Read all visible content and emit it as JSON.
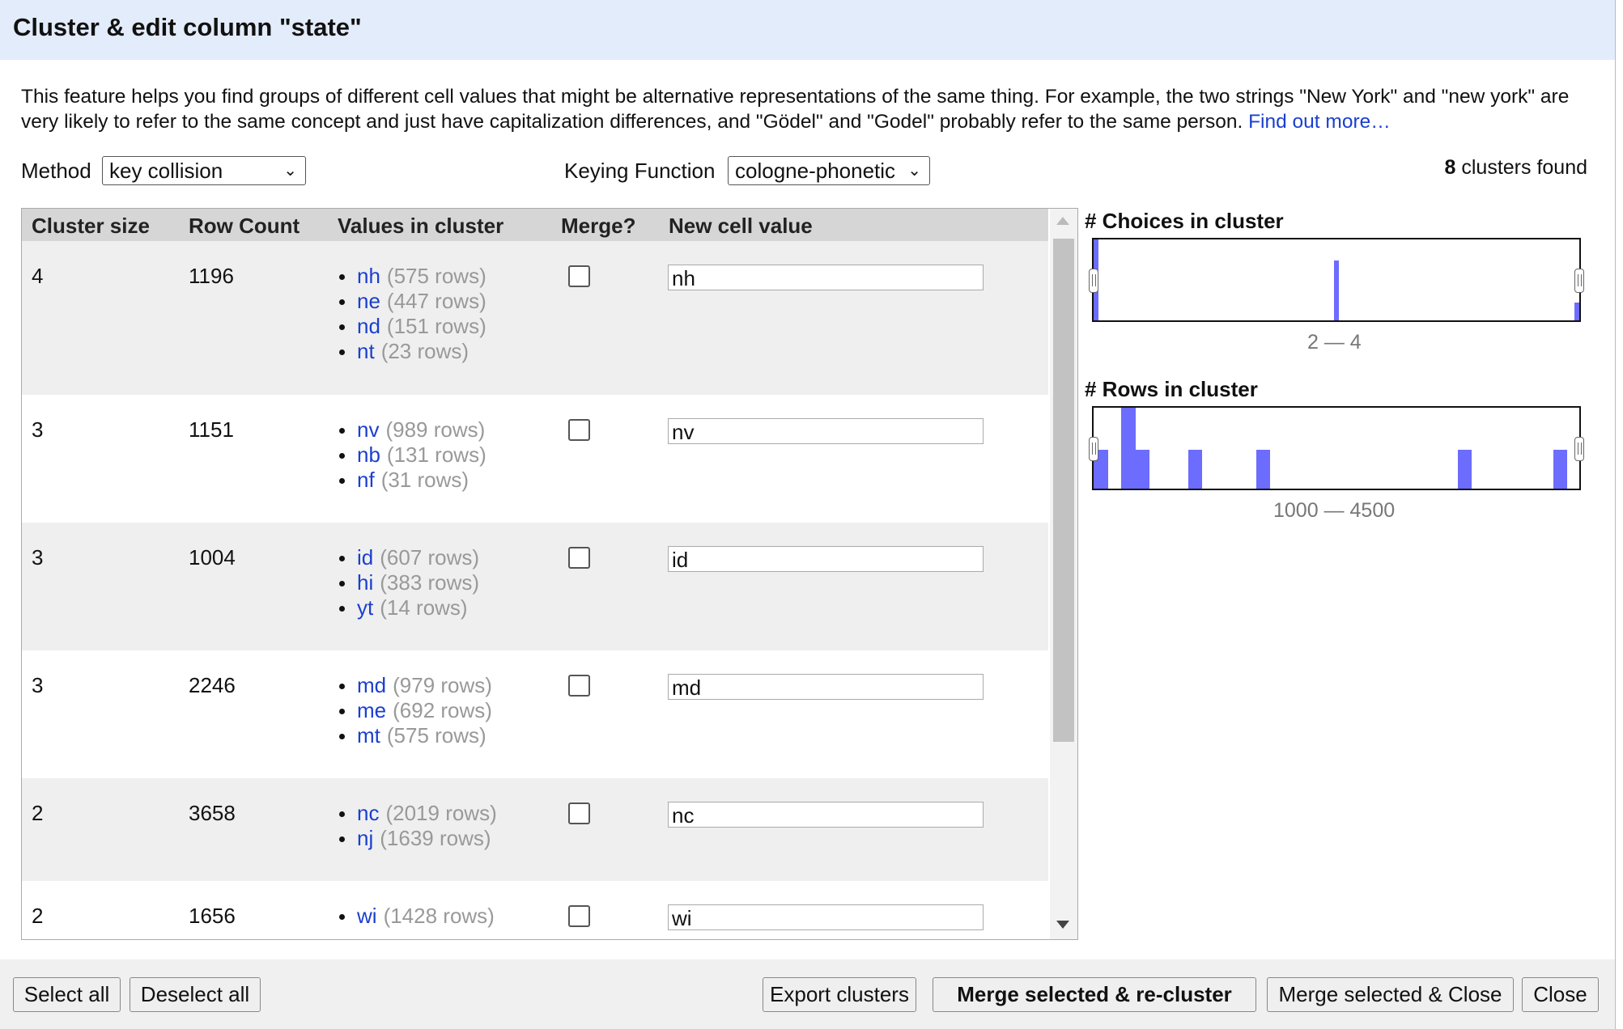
{
  "dialog": {
    "title": "Cluster & edit column \"state\"",
    "description": "This feature helps you find groups of different cell values that might be alternative representations of the same thing. For example, the two strings \"New York\" and \"new york\" are very likely to refer to the same concept and just have capitalization differences, and \"Gödel\" and \"Godel\" probably refer to the same person.",
    "find_out_more": "Find out more…"
  },
  "controls": {
    "method_label": "Method",
    "method_value": "key collision",
    "keying_label": "Keying Function",
    "keying_value": "cologne-phonetic",
    "clusters_count": "8",
    "clusters_found_text": "clusters found"
  },
  "table": {
    "headers": [
      "Cluster size",
      "Row Count",
      "Values in cluster",
      "Merge?",
      "New cell value"
    ],
    "rows": [
      {
        "size": "4",
        "count": "1196",
        "values": [
          {
            "v": "nh",
            "c": "(575 rows)"
          },
          {
            "v": "ne",
            "c": "(447 rows)"
          },
          {
            "v": "nd",
            "c": "(151 rows)"
          },
          {
            "v": "nt",
            "c": "(23 rows)"
          }
        ],
        "merge": false,
        "new_value": "nh"
      },
      {
        "size": "3",
        "count": "1151",
        "values": [
          {
            "v": "nv",
            "c": "(989 rows)"
          },
          {
            "v": "nb",
            "c": "(131 rows)"
          },
          {
            "v": "nf",
            "c": "(31 rows)"
          }
        ],
        "merge": false,
        "new_value": "nv"
      },
      {
        "size": "3",
        "count": "1004",
        "values": [
          {
            "v": "id",
            "c": "(607 rows)"
          },
          {
            "v": "hi",
            "c": "(383 rows)"
          },
          {
            "v": "yt",
            "c": "(14 rows)"
          }
        ],
        "merge": false,
        "new_value": "id"
      },
      {
        "size": "3",
        "count": "2246",
        "values": [
          {
            "v": "md",
            "c": "(979 rows)"
          },
          {
            "v": "me",
            "c": "(692 rows)"
          },
          {
            "v": "mt",
            "c": "(575 rows)"
          }
        ],
        "merge": false,
        "new_value": "md"
      },
      {
        "size": "2",
        "count": "3658",
        "values": [
          {
            "v": "nc",
            "c": "(2019 rows)"
          },
          {
            "v": "nj",
            "c": "(1639 rows)"
          }
        ],
        "merge": false,
        "new_value": "nc"
      },
      {
        "size": "2",
        "count": "1656",
        "values": [
          {
            "v": "wi",
            "c": "(1428 rows)"
          }
        ],
        "merge": false,
        "new_value": "wi"
      }
    ]
  },
  "facets": {
    "choices": {
      "title": "# Choices in cluster",
      "range": "2 — 4"
    },
    "rows": {
      "title": "# Rows in cluster",
      "range": "1000 — 4500"
    }
  },
  "buttons": {
    "select_all": "Select all",
    "deselect_all": "Deselect all",
    "export": "Export clusters",
    "merge_recluster": "Merge selected & re-cluster",
    "merge_close": "Merge selected & Close",
    "close": "Close"
  },
  "colors": {
    "accent_link": "#1a3fcf",
    "histogram_bar": "#6c6cff",
    "title_bg": "#e3ecfa"
  }
}
